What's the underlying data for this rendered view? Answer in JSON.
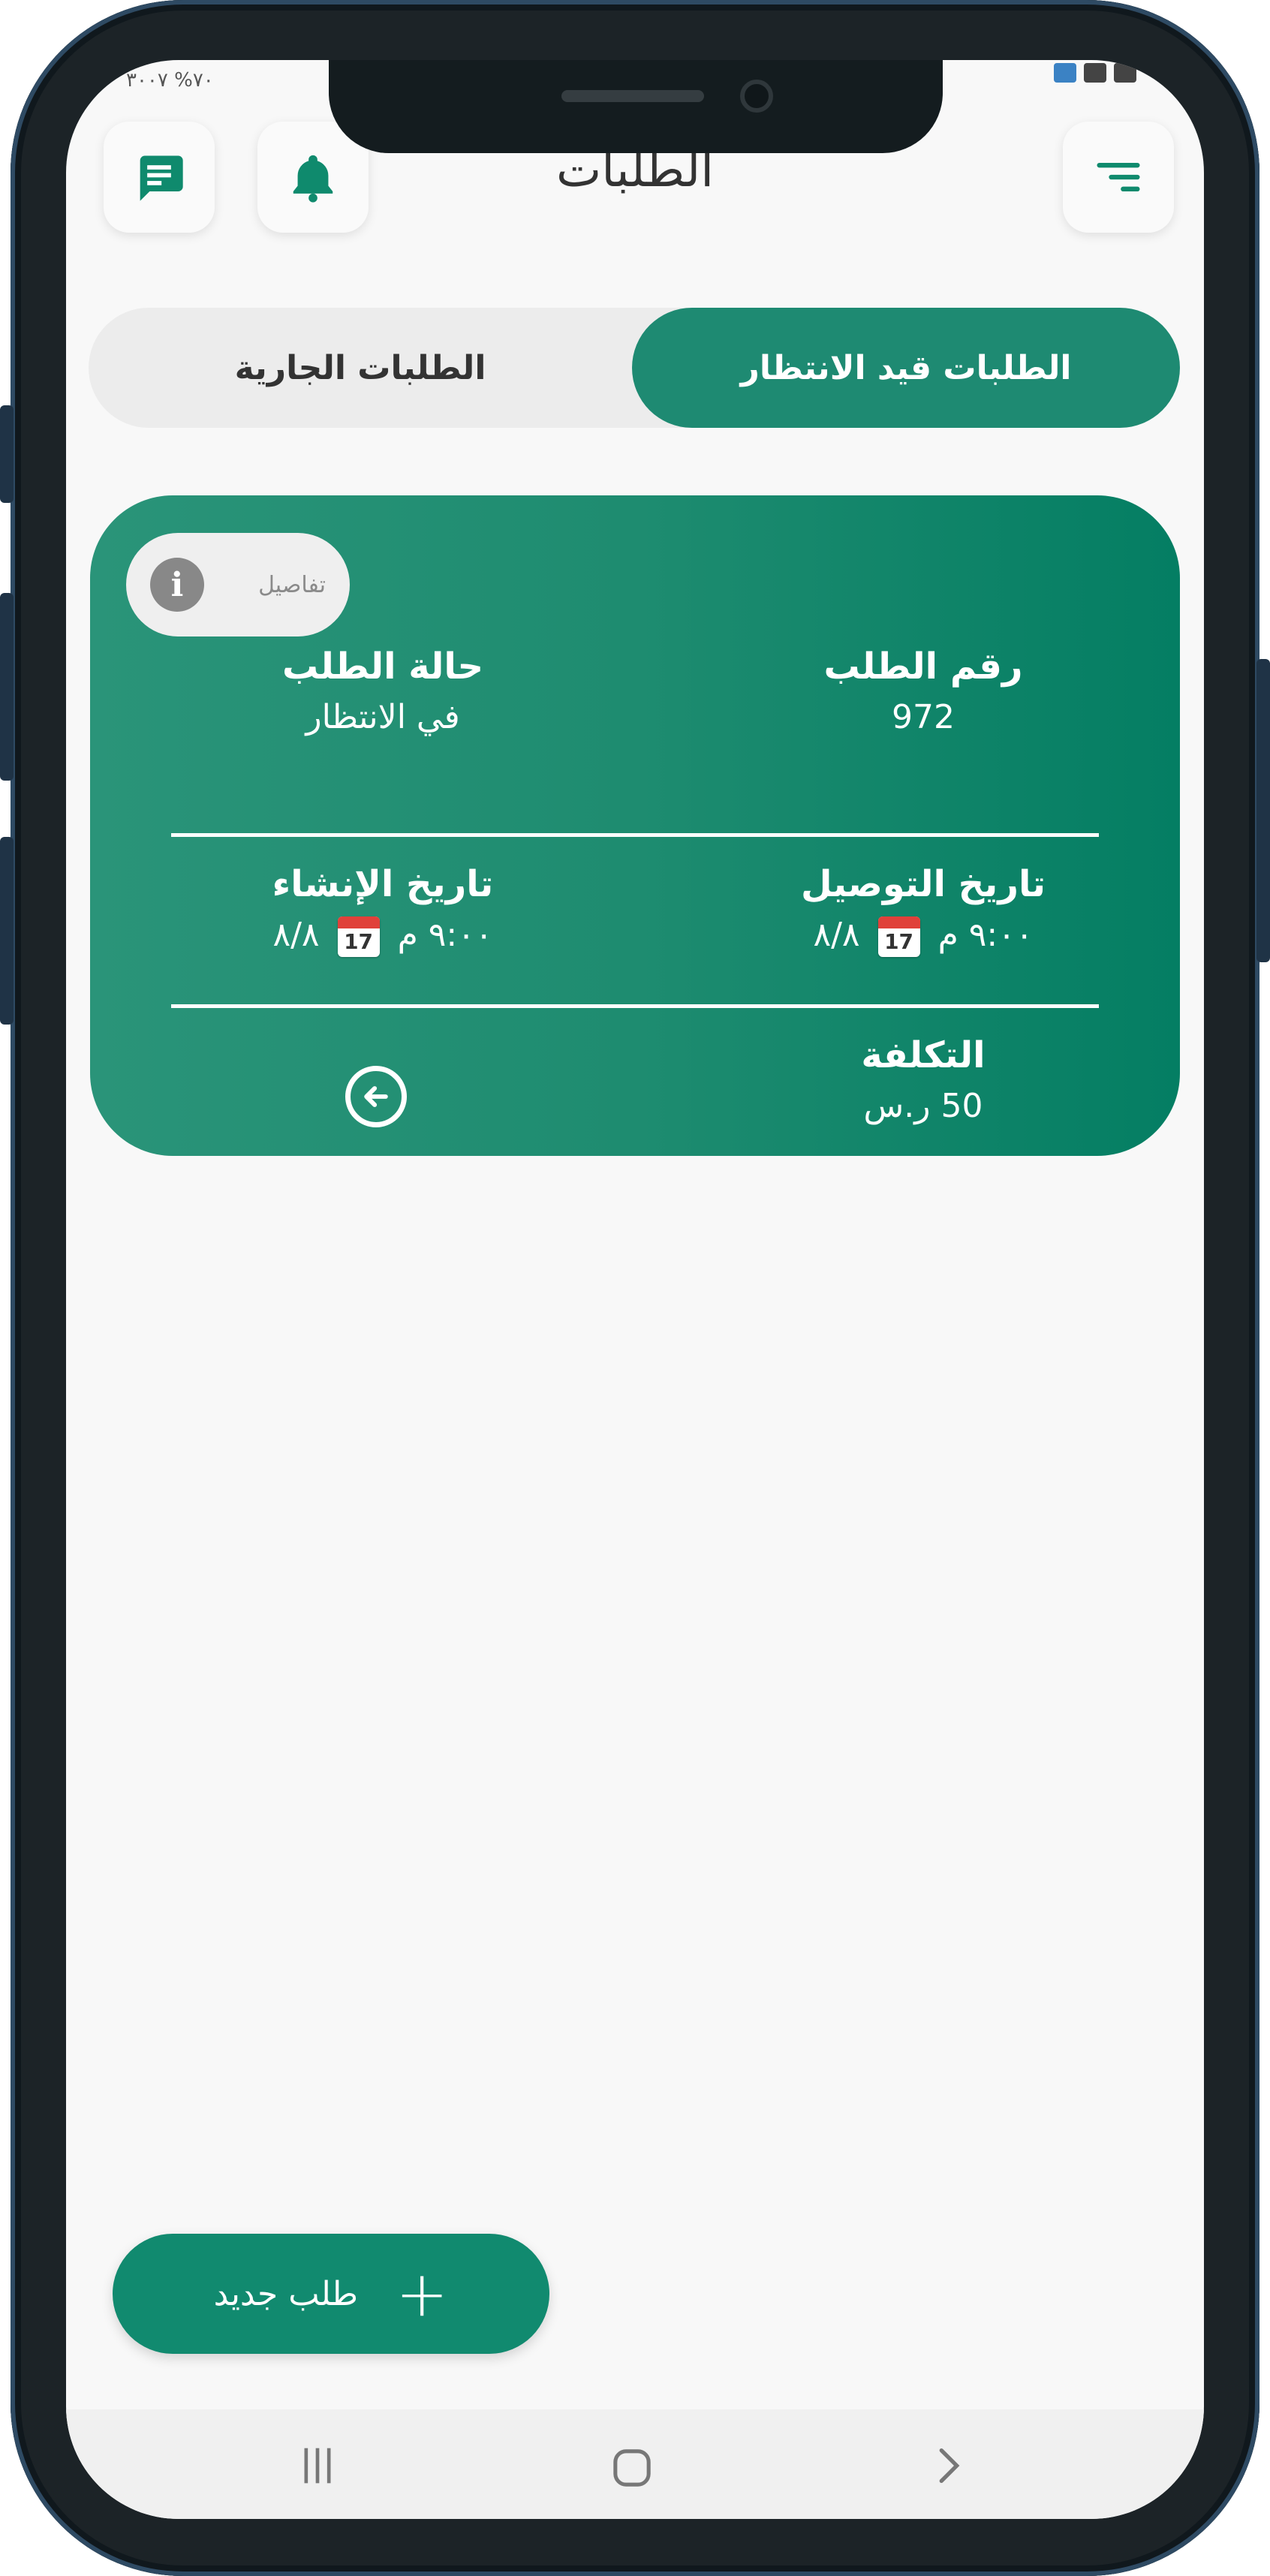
{
  "status_bar": {
    "left_text": "٧٠% ٣٠٠٧"
  },
  "header": {
    "title": "الطلبات",
    "menu_icon": "filter-menu-icon",
    "notification_icon": "bell-icon",
    "messages_icon": "chat-message-icon"
  },
  "tabs": [
    {
      "label": "الطلبات قيد الانتظار",
      "active": true
    },
    {
      "label": "الطلبات الجارية",
      "active": false
    }
  ],
  "order_card": {
    "details_label": "تفاصيل",
    "order_number_label": "رقم الطلب",
    "order_number": "972",
    "status_label": "حالة الطلب",
    "status": "في الانتظار",
    "delivery_date_label": "تاريخ التوصيل",
    "delivery_time": "٩:٠٠ م",
    "delivery_date": "٨/٨",
    "created_date_label": "تاريخ الإنشاء",
    "created_time": "٩:٠٠ م",
    "created_date": "٨/٨",
    "calendar_day": "17",
    "cost_label": "التكلفة",
    "cost": "50 ر.س"
  },
  "new_order_button": {
    "label": "طلب جديد",
    "icon": "plus-icon"
  },
  "system_nav": {
    "recents_icon": "recents-icon",
    "home_icon": "home-icon",
    "back_icon": "back-icon"
  },
  "colors": {
    "primary": "#1e8a72",
    "card_start": "#2a9479",
    "card_end": "#047e63",
    "background": "#f8f8f8"
  }
}
